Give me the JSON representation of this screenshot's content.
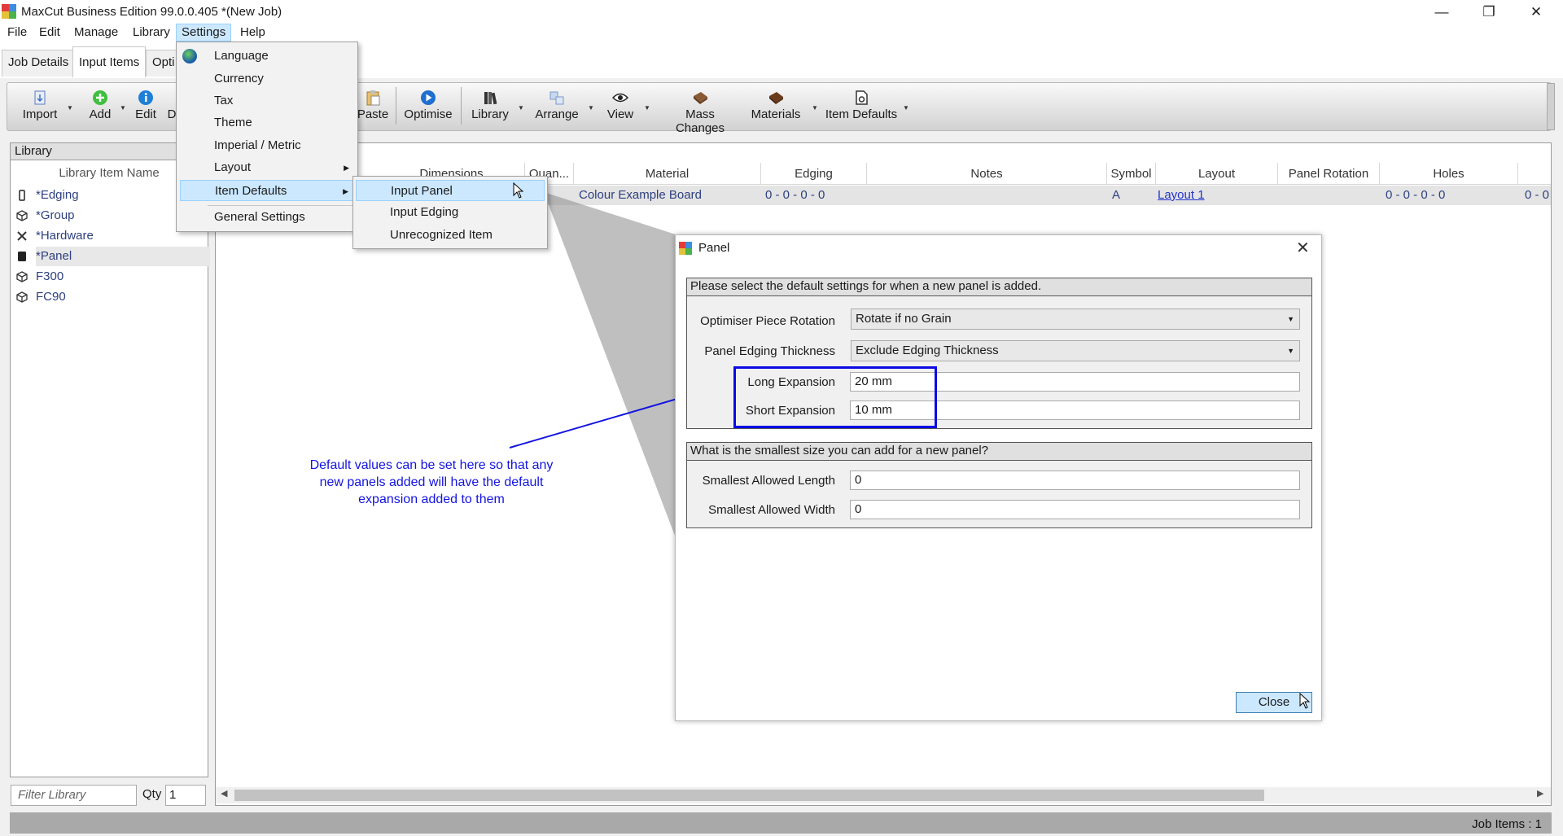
{
  "window": {
    "title": "MaxCut Business Edition 99.0.0.405 *(New Job)",
    "minimize": "—",
    "restore": "❐",
    "close": "✕"
  },
  "menubar": [
    "File",
    "Edit",
    "Manage",
    "Library",
    "Settings",
    "Help"
  ],
  "tabs": [
    "Job Details",
    "Input Items",
    "Opti"
  ],
  "toolbar": {
    "import": "Import",
    "add": "Add",
    "edit": "Edit",
    "d": "D",
    "paste": "Paste",
    "optimise": "Optimise",
    "library": "Library",
    "arrange": "Arrange",
    "view": "View",
    "mass_changes": "Mass Changes",
    "materials": "Materials",
    "item_defaults": "Item Defaults"
  },
  "library": {
    "header": "Library",
    "column": "Library Item Name",
    "items": [
      "*Edging",
      "*Group",
      "*Hardware",
      "*Panel",
      "F300",
      "FC90"
    ],
    "filter_placeholder": "Filter Library",
    "qty_label": "Qty",
    "qty_value": "1"
  },
  "grid": {
    "columns": [
      "Dimensions",
      "Quan...",
      "Material",
      "Edging",
      "Notes",
      "Symbol",
      "Layout",
      "Panel Rotation",
      "Holes"
    ],
    "row": {
      "material": "Colour Example Board",
      "edging": "0 - 0 - 0 - 0",
      "symbol": "A",
      "layout": "Layout 1",
      "holes": "0 - 0 - 0 - 0",
      "extra": "0 - 0"
    }
  },
  "settings_menu": {
    "items": [
      "Language",
      "Currency",
      "Tax",
      "Theme",
      "Imperial / Metric",
      "Layout",
      "Item Defaults",
      "General Settings"
    ],
    "submenu_arrow": "▶"
  },
  "submenu": {
    "items": [
      "Input Panel",
      "Input Edging",
      "Unrecognized Item"
    ]
  },
  "dialog": {
    "title": "Panel",
    "close_x": "✕",
    "group1_header": "Please select the default settings for when a new panel is added.",
    "rotation_label": "Optimiser Piece Rotation",
    "rotation_value": "Rotate if no Grain",
    "edging_label": "Panel  Edging Thickness",
    "edging_value": "Exclude Edging Thickness",
    "long_label": "Long Expansion",
    "long_value": "20 mm",
    "short_label": "Short Expansion",
    "short_value": "10 mm",
    "group2_header": "What is the smallest size you can add for a new panel?",
    "min_length_label": "Smallest Allowed Length",
    "min_length_value": "0",
    "min_width_label": "Smallest Allowed Width",
    "min_width_value": "0",
    "close_button": "Close"
  },
  "annotation": "Default values can be set here so that any new panels added will have the default expansion added to them",
  "status": "Job Items :  1",
  "colors": {
    "accent_highlight": "#cce8ff",
    "annotation_blue": "#1414e0",
    "link_text": "#2d3f7e"
  }
}
